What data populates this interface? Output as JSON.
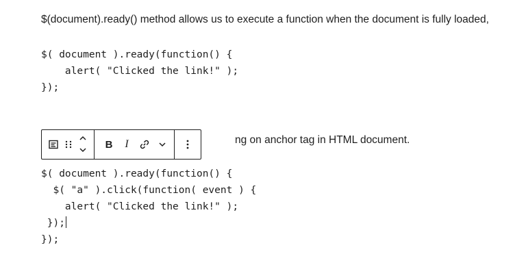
{
  "intro_paragraph": "$(document).ready() method allows us to execute a function when the document is fully loaded,",
  "code_block_1": {
    "lines": [
      "$( document ).ready(function() {",
      "    alert( \"Clicked the link!\" );",
      "});"
    ]
  },
  "partial_paragraph": "ng on anchor tag in HTML document.",
  "block_toolbar": {
    "buttons": [
      {
        "name": "block-type-icon",
        "group": 1
      },
      {
        "name": "drag-handle-icon",
        "group": 1
      },
      {
        "name": "move-up-down",
        "group": 1
      },
      {
        "name": "bold",
        "label": "B",
        "group": 2
      },
      {
        "name": "italic",
        "label": "I",
        "group": 2
      },
      {
        "name": "link-icon",
        "group": 2
      },
      {
        "name": "more-rich-text-chevron-icon",
        "group": 2
      },
      {
        "name": "options-icon",
        "group": 3
      }
    ],
    "bold_label": "B",
    "italic_label": "I"
  },
  "code_block_2": {
    "lines": [
      "$( document ).ready(function() {",
      "  $( \"a\" ).click(function( event ) {",
      "    alert( \"Clicked the link!\" );",
      " });",
      "});"
    ]
  }
}
